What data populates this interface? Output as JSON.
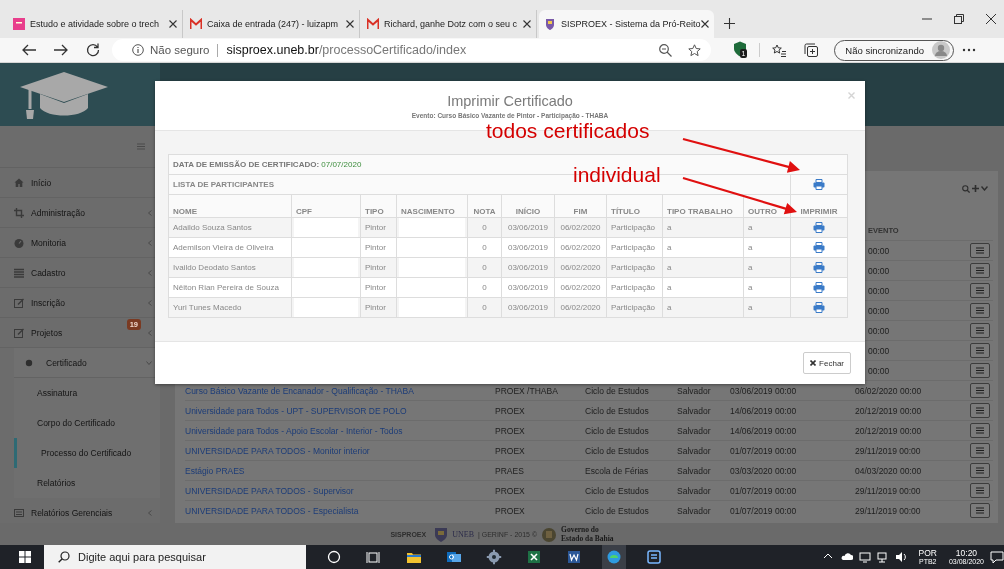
{
  "browser": {
    "tabs": [
      {
        "kind": "doc",
        "title": "Estudo e atividade sobre o trech",
        "selected": false
      },
      {
        "kind": "mail",
        "title": "Caixa de entrada (247) - luizapm",
        "selected": false
      },
      {
        "kind": "mail",
        "title": "Richard, ganhe Dotz com o seu c",
        "selected": false
      },
      {
        "kind": "site",
        "title": "SISPROEX - Sistema da Pró-Reito",
        "selected": true
      }
    ],
    "security_label": "Não seguro",
    "url_host": "sisproex.uneb.br",
    "url_path": "/processoCertificado/index",
    "extension_badge": "1",
    "sync_button": "Não sincronizando"
  },
  "sidebar": {
    "items": [
      {
        "label": "Início",
        "selected": false
      },
      {
        "label": "Administração",
        "expanded": false,
        "selected": false
      },
      {
        "label": "Monitoria",
        "expanded": false,
        "selected": false
      },
      {
        "label": "Cadastro",
        "expanded": false,
        "selected": false
      },
      {
        "label": "Inscrição",
        "expanded": false,
        "selected": false
      },
      {
        "label": "Projetos",
        "expanded": false,
        "badge": "19",
        "selected": false
      },
      {
        "label": "Certificado",
        "expanded": true,
        "selected": true,
        "children": [
          {
            "label": "Assinatura",
            "selected": false
          },
          {
            "label": "Corpo do Certificado",
            "selected": false
          },
          {
            "label": "Processo do Certificado",
            "selected": true
          },
          {
            "label": "Relatórios",
            "selected": false
          }
        ]
      },
      {
        "label": "Relatórios Gerenciais",
        "expanded": false,
        "selected": false
      }
    ]
  },
  "events_table": {
    "end_header": "EVENTO",
    "rows": [
      {
        "end": "00:00"
      },
      {
        "end": "00:00"
      },
      {
        "end": "00:00"
      },
      {
        "end": "00:00"
      },
      {
        "end": "00:00"
      },
      {
        "end": "00:00"
      },
      {
        "end": "00:00"
      },
      {
        "title": "Curso Básico Vazante de Encanador - Qualificação - THABA",
        "org": "PROEX /THABA",
        "type": "Ciclo de Estudos",
        "city": "Salvador",
        "start": "03/06/2019 00:00",
        "end": "06/02/2020 00:00"
      },
      {
        "title": "Universidade para Todos - UPT - SUPERVISOR DE POLO",
        "org": "PROEX",
        "type": "Ciclo de Estudos",
        "city": "Salvador",
        "start": "14/06/2019 00:00",
        "end": "20/12/2019 00:00"
      },
      {
        "title": "Universidade para Todos - Apoio Escolar - Interior - Todos",
        "org": "PROEX",
        "type": "Ciclo de Estudos",
        "city": "Salvador",
        "start": "14/06/2019 00:00",
        "end": "20/12/2019 00:00"
      },
      {
        "title": "UNIVERSIDADE PARA TODOS - Monitor interior",
        "org": "PROEX",
        "type": "Ciclo de Estudos",
        "city": "Salvador",
        "start": "01/07/2019 00:00",
        "end": "29/11/2019 00:00"
      },
      {
        "title": "Estágio PRAES",
        "org": "PRAES",
        "type": "Escola de Férias",
        "city": "Salvador",
        "start": "03/03/2020 00:00",
        "end": "04/03/2020 00:00"
      },
      {
        "title": "UNIVERSIDADE PARA TODOS - Supervisor",
        "org": "PROEX",
        "type": "Ciclo de Estudos",
        "city": "Salvador",
        "start": "01/07/2019 00:00",
        "end": "29/11/2019 00:00"
      },
      {
        "title": "UNIVERSIDADE PARA TODOS - Especialista",
        "org": "PROEX",
        "type": "Ciclo de Estudos",
        "city": "Salvador",
        "start": "01/07/2019 00:00",
        "end": "29/11/2019 00:00"
      }
    ]
  },
  "modal": {
    "title": "Imprimir Certificado",
    "subtitle": "Evento: Curso Básico Vazante de Pintor - Participação - THABA",
    "issue_label": "DATA DE EMISSÃO DE CERTIFICADO:",
    "issue_date": "07/07/2020",
    "list_label": "LISTA DE PARTICIPANTES",
    "columns": [
      "NOME",
      "CPF",
      "TIPO",
      "NASCIMENTO",
      "NOTA",
      "INÍCIO",
      "FIM",
      "TÍTULO",
      "TIPO TRABALHO",
      "OUTRO",
      "IMPRIMIR"
    ],
    "rows": [
      {
        "name": "Adaildo Souza Santos",
        "cpf_redacted": true,
        "type": "Pintor",
        "birth_redacted": true,
        "grade": "0",
        "start": "03/06/2019",
        "end": "06/02/2020",
        "title": "Participação",
        "work_type": "a",
        "other": "a"
      },
      {
        "name": "Ademilson Vieira de Oliveira",
        "cpf_redacted": true,
        "type": "Pintor",
        "birth_redacted": true,
        "grade": "0",
        "start": "03/06/2019",
        "end": "06/02/2020",
        "title": "Participação",
        "work_type": "a",
        "other": "a"
      },
      {
        "name": "Ivaildo Deodato Santos",
        "cpf_redacted": true,
        "type": "Pintor",
        "birth_redacted": true,
        "grade": "0",
        "start": "03/06/2019",
        "end": "06/02/2020",
        "title": "Participação",
        "work_type": "a",
        "other": "a"
      },
      {
        "name": "Nêiton Rian Pereira de Souza",
        "cpf_redacted": true,
        "type": "Pintor",
        "birth_redacted": true,
        "grade": "0",
        "start": "03/06/2019",
        "end": "06/02/2020",
        "title": "Participação",
        "work_type": "a",
        "other": "a"
      },
      {
        "name": "Yuri Tunes Macedo",
        "cpf_redacted": true,
        "type": "Pintor",
        "birth_redacted": true,
        "grade": "0",
        "start": "03/06/2019",
        "end": "06/02/2020",
        "title": "Participação",
        "work_type": "a",
        "other": "a"
      }
    ],
    "close_button": "Fechar"
  },
  "annotations": [
    {
      "text": "todos certificados"
    },
    {
      "text": "individual"
    }
  ],
  "footer": {
    "brand": "SISPROEX",
    "uneb": "UNEB",
    "credit": "| GERINF - 2015 ©",
    "gov_line_1": "Governo do",
    "gov_line_2": "Estado da Bahia"
  },
  "taskbar": {
    "search_placeholder": "Digite aqui para pesquisar",
    "language": "POR",
    "layout": "PTB2",
    "time": "10:20",
    "date": "03/08/2020"
  }
}
